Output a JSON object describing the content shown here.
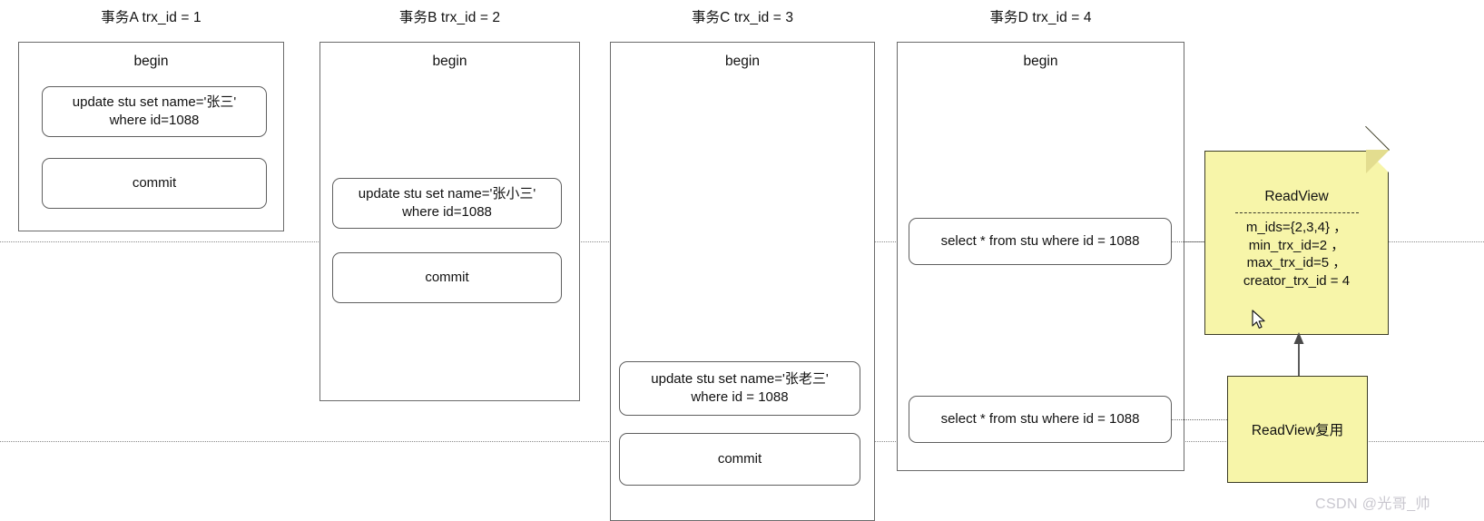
{
  "diagram": {
    "type": "mysql-mvcc-readview-timeline",
    "transactions": [
      {
        "header": "事务A trx_id = 1",
        "begin_label": "begin",
        "statements": [
          {
            "line1": "update stu set name='张三'",
            "line2": "where id=1088"
          },
          {
            "line1": "commit",
            "line2": ""
          }
        ]
      },
      {
        "header": "事务B trx_id = 2",
        "begin_label": "begin",
        "statements": [
          {
            "line1": "update stu set name='张小三'",
            "line2": "where id=1088"
          },
          {
            "line1": "commit",
            "line2": ""
          }
        ]
      },
      {
        "header": "事务C trx_id = 3",
        "begin_label": "begin",
        "statements": [
          {
            "line1": "update stu set name='张老三'",
            "line2": "where id = 1088"
          },
          {
            "line1": "commit",
            "line2": ""
          }
        ]
      },
      {
        "header": "事务D trx_id = 4",
        "begin_label": "begin",
        "statements": [
          {
            "line1": "select * from stu where id = 1088",
            "line2": ""
          },
          {
            "line1": "select * from stu where id = 1088",
            "line2": ""
          }
        ]
      }
    ],
    "readview_note": {
      "title": "ReadView",
      "fields": [
        "m_ids={2,3,4} ，",
        "min_trx_id=2  ，",
        "max_trx_id=5  ，",
        "creator_trx_id = 4"
      ]
    },
    "readview_reuse_note": {
      "label": "ReadView复用"
    },
    "watermark": "CSDN @光哥_帅",
    "colors": {
      "note_fill": "#f7f5a9",
      "note_border": "#3d3d26",
      "box_border": "#6b6b6b",
      "statement_border": "#5f5f5f",
      "timeline": "#8a8a8a",
      "watermark": "#c9c7cf"
    }
  }
}
